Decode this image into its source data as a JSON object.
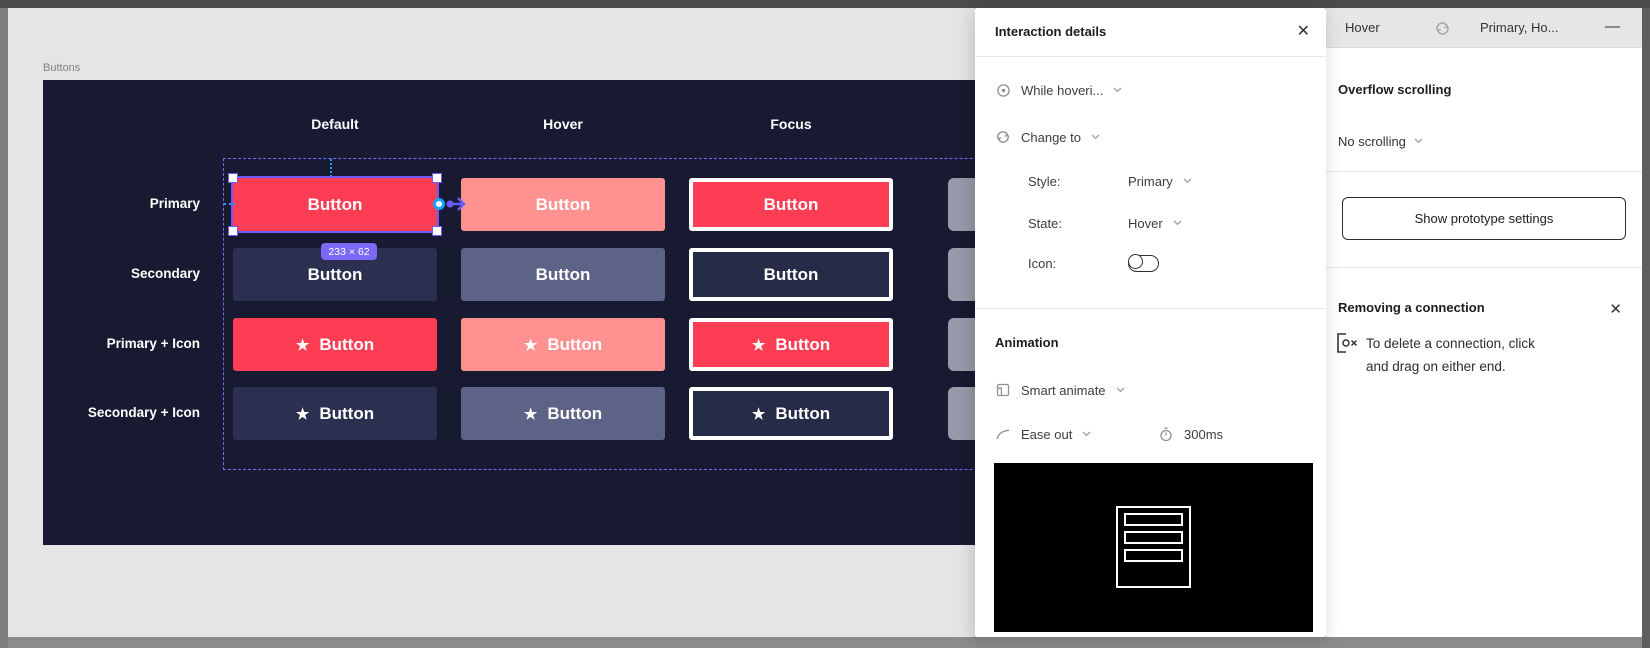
{
  "canvas": {
    "frame_label": "Buttons",
    "column_headers": [
      "Default",
      "Hover",
      "Focus"
    ],
    "row_labels": [
      "Primary",
      "Secondary",
      "Primary + Icon",
      "Secondary + Icon"
    ],
    "rows": [
      {
        "style": "primary",
        "icon": false
      },
      {
        "style": "secondary",
        "icon": false
      },
      {
        "style": "primary",
        "icon": true
      },
      {
        "style": "secondary",
        "icon": true
      }
    ],
    "states": [
      "default",
      "hover",
      "focus"
    ],
    "button_label": "Button",
    "star_icon": "★",
    "selection_badge": "233 × 62",
    "colors": {
      "frame_bg": "#171a30",
      "primary": "#fc3d53",
      "primary_hover": "#ff9191",
      "secondary": "#2b3051",
      "secondary_hover": "#5c6386",
      "secondary_focus": "#262b48",
      "partial_gray": "#979aa8",
      "selection_purple": "#6b5cf7",
      "dashed_purple": "#7b68ff",
      "guide_cyan": "#18a0fb",
      "badge_bg": "#7b68f7"
    }
  },
  "popup": {
    "title": "Interaction details",
    "close_icon": "✕",
    "trigger": {
      "label": "While hoveri..."
    },
    "action": {
      "label": "Change to"
    },
    "fields": [
      {
        "label": "Style:",
        "value": "Primary"
      },
      {
        "label": "State:",
        "value": "Hover"
      }
    ],
    "icon_field": {
      "label": "Icon:",
      "state": "off"
    },
    "animation": {
      "heading": "Animation",
      "type": "Smart animate",
      "easing": "Ease out",
      "duration": "300ms"
    }
  },
  "sidebar": {
    "interaction_row": {
      "trigger": "Hover",
      "destination": "Primary, Ho...",
      "remove_glyph": "—"
    },
    "overflow": {
      "heading": "Overflow scrolling",
      "value": "No scrolling"
    },
    "settings_button": "Show prototype settings",
    "tip": {
      "heading": "Removing a connection",
      "close_icon": "✕",
      "line1": "To delete a connection, click",
      "line2": "and drag on either end."
    }
  }
}
